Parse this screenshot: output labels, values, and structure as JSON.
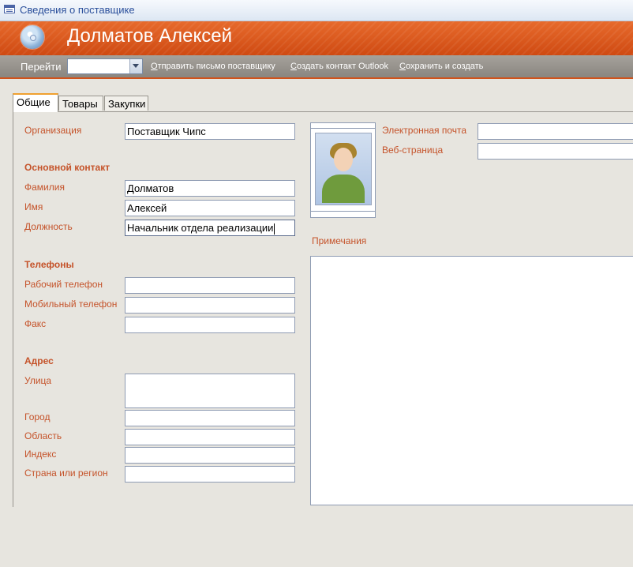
{
  "window": {
    "title": "Сведения о поставщике",
    "form_icon": "form-icon"
  },
  "header": {
    "logo_icon": "cd-disc-icon",
    "name": "Долматов Алексей",
    "colors": {
      "header_orange": "#d9561b",
      "label_orange": "#c5532a"
    }
  },
  "navbar": {
    "go_label": "Перейти",
    "go_value": "",
    "commands": [
      {
        "pre": "",
        "u": "О",
        "post": "тправить письмо поставщику"
      },
      {
        "pre": "",
        "u": "С",
        "post": "оздать контакт Outlook"
      },
      {
        "pre": "",
        "u": "С",
        "post": "охранить и создать"
      }
    ]
  },
  "tabs": [
    {
      "label": "Общие",
      "active": true
    },
    {
      "label": "Товары",
      "active": false
    },
    {
      "label": "Закупки",
      "active": false
    }
  ],
  "form": {
    "organization": {
      "label": "Организация",
      "value": "Поставщик Чипс"
    },
    "main_contact_header": "Основной контакт",
    "last_name": {
      "label": "Фамилия",
      "value": "Долматов"
    },
    "first_name": {
      "label": "Имя",
      "value": "Алексей"
    },
    "position": {
      "label": "Должность",
      "value": "Начальник отдела реализации"
    },
    "phones_header": "Телефоны",
    "work_phone": {
      "label": "Рабочий телефон",
      "value": ""
    },
    "mobile_phone": {
      "label": "Мобильный телефон",
      "value": ""
    },
    "fax": {
      "label": "Факс",
      "value": ""
    },
    "address_header": "Адрес",
    "street": {
      "label": "Улица",
      "value": ""
    },
    "city": {
      "label": "Город",
      "value": ""
    },
    "region": {
      "label": "Область",
      "value": ""
    },
    "zip": {
      "label": "Индекс",
      "value": ""
    },
    "country": {
      "label": "Страна или регион",
      "value": ""
    },
    "email": {
      "label": "Электронная почта",
      "value": ""
    },
    "website": {
      "label": "Веб-страница",
      "value": ""
    },
    "notes": {
      "label": "Примечания",
      "value": ""
    },
    "photo_icon": "person-photo-icon"
  }
}
